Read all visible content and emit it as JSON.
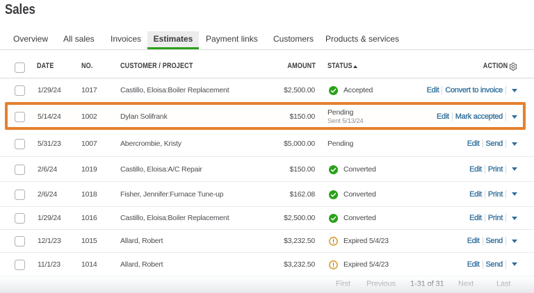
{
  "page": {
    "title": "Sales"
  },
  "tabs": [
    {
      "label": "Overview",
      "selected": false
    },
    {
      "label": "All sales",
      "selected": false
    },
    {
      "label": "Invoices",
      "selected": false
    },
    {
      "label": "Estimates",
      "selected": true
    },
    {
      "label": "Payment links",
      "selected": false
    },
    {
      "label": "Customers",
      "selected": false
    },
    {
      "label": "Products & services",
      "selected": false
    }
  ],
  "table": {
    "headers": {
      "date": "DATE",
      "no": "NO.",
      "customer": "CUSTOMER / PROJECT",
      "amount": "AMOUNT",
      "status": "STATUS",
      "action": "ACTION"
    },
    "sort": {
      "column": "STATUS",
      "direction": "ascending"
    },
    "icons": {
      "action_settings": "gear-icon",
      "status_sort": "sort-ascending-icon"
    },
    "rows": [
      {
        "date": "1/29/24",
        "no": "1017",
        "customer": "Castillo, Eloisa:Boiler Replacement",
        "amount": "$2,500.00",
        "status": {
          "icon": "success",
          "label": "Accepted",
          "sub": ""
        },
        "actions": {
          "edit": "Edit",
          "primary": "Convert to invoice"
        },
        "highlighted": false
      },
      {
        "date": "5/14/24",
        "no": "1002",
        "customer": "Dylan Solifrank",
        "amount": "$150.00",
        "status": {
          "icon": "none",
          "label": "Pending",
          "sub": "Sent 5/13/24"
        },
        "actions": {
          "edit": "Edit",
          "primary": "Mark accepted"
        },
        "highlighted": true
      },
      {
        "date": "5/31/23",
        "no": "1007",
        "customer": "Abercrombie, Kristy",
        "amount": "$5,000.00",
        "status": {
          "icon": "none",
          "label": "Pending",
          "sub": ""
        },
        "actions": {
          "edit": "Edit",
          "primary": "Send"
        },
        "highlighted": false
      },
      {
        "date": "2/6/24",
        "no": "1019",
        "customer": "Castillo, Eloisa:A/C Repair",
        "amount": "$150.00",
        "status": {
          "icon": "success",
          "label": "Converted",
          "sub": ""
        },
        "actions": {
          "edit": "Edit",
          "primary": "Print"
        },
        "highlighted": false
      },
      {
        "date": "2/6/24",
        "no": "1018",
        "customer": "Fisher, Jennifer:Furnace Tune-up",
        "amount": "$162.08",
        "status": {
          "icon": "success",
          "label": "Converted",
          "sub": ""
        },
        "actions": {
          "edit": "Edit",
          "primary": "Print"
        },
        "highlighted": false
      },
      {
        "date": "1/29/24",
        "no": "1016",
        "customer": "Castillo, Eloisa:Boiler Replacement",
        "amount": "$2,500.00",
        "status": {
          "icon": "success",
          "label": "Converted",
          "sub": ""
        },
        "actions": {
          "edit": "Edit",
          "primary": "Print"
        },
        "highlighted": false
      },
      {
        "date": "12/1/23",
        "no": "1015",
        "customer": "Allard, Robert",
        "amount": "$3,232.50",
        "status": {
          "icon": "warning",
          "label": "Expired 5/4/23",
          "sub": ""
        },
        "actions": {
          "edit": "Edit",
          "primary": "Send"
        },
        "highlighted": false
      },
      {
        "date": "11/1/23",
        "no": "1014",
        "customer": "Allard, Robert",
        "amount": "$3,232.50",
        "status": {
          "icon": "warning",
          "label": "Expired 5/4/23",
          "sub": ""
        },
        "actions": {
          "edit": "Edit",
          "primary": "Send"
        },
        "highlighted": false
      }
    ]
  },
  "pagination": {
    "first": "First",
    "previous": "Previous",
    "range": "1-31 of 31",
    "next": "Next",
    "last": "Last"
  },
  "colors": {
    "brand_green": "#2ca01c",
    "link_blue": "#2d6e9b",
    "highlight_orange": "#e5802e",
    "warning_amber": "#dba33c",
    "text_dark": "#393a3d",
    "text_gray": "#8d9096"
  }
}
